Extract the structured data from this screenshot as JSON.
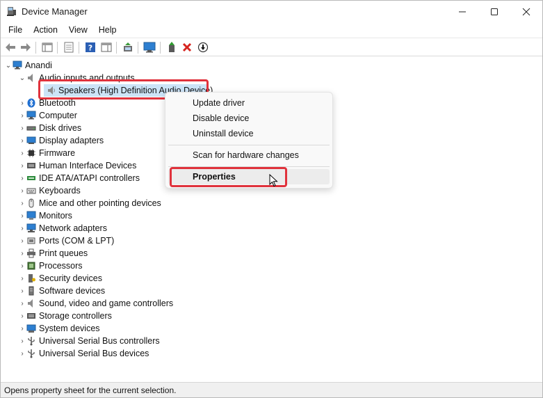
{
  "window": {
    "title": "Device Manager"
  },
  "menu": [
    "File",
    "Action",
    "View",
    "Help"
  ],
  "toolbar": {
    "buttons": [
      "back-icon",
      "forward-icon",
      "show-hide-console-tree-icon",
      "properties-icon",
      "help-icon",
      "action-pane-icon",
      "update-driver-icon",
      "scan-hardware-icon",
      "enable-device-icon",
      "uninstall-icon",
      "download-icon"
    ]
  },
  "tree": {
    "root": "Anandi",
    "audio_category": "Audio inputs and outputs",
    "speakers": "Speakers (High Definition Audio Device)",
    "categories": [
      "Bluetooth",
      "Computer",
      "Disk drives",
      "Display adapters",
      "Firmware",
      "Human Interface Devices",
      "IDE ATA/ATAPI controllers",
      "Keyboards",
      "Mice and other pointing devices",
      "Monitors",
      "Network adapters",
      "Ports (COM & LPT)",
      "Print queues",
      "Processors",
      "Security devices",
      "Software devices",
      "Sound, video and game controllers",
      "Storage controllers",
      "System devices",
      "Universal Serial Bus controllers",
      "Universal Serial Bus devices"
    ]
  },
  "context_menu": {
    "update_driver": "Update driver",
    "disable_device": "Disable device",
    "uninstall_device": "Uninstall device",
    "scan": "Scan for hardware changes",
    "properties": "Properties"
  },
  "status": {
    "text": "Opens property sheet for the current selection."
  },
  "colors": {
    "highlight_box": "#e0323c",
    "selection": "#cce4f7"
  }
}
